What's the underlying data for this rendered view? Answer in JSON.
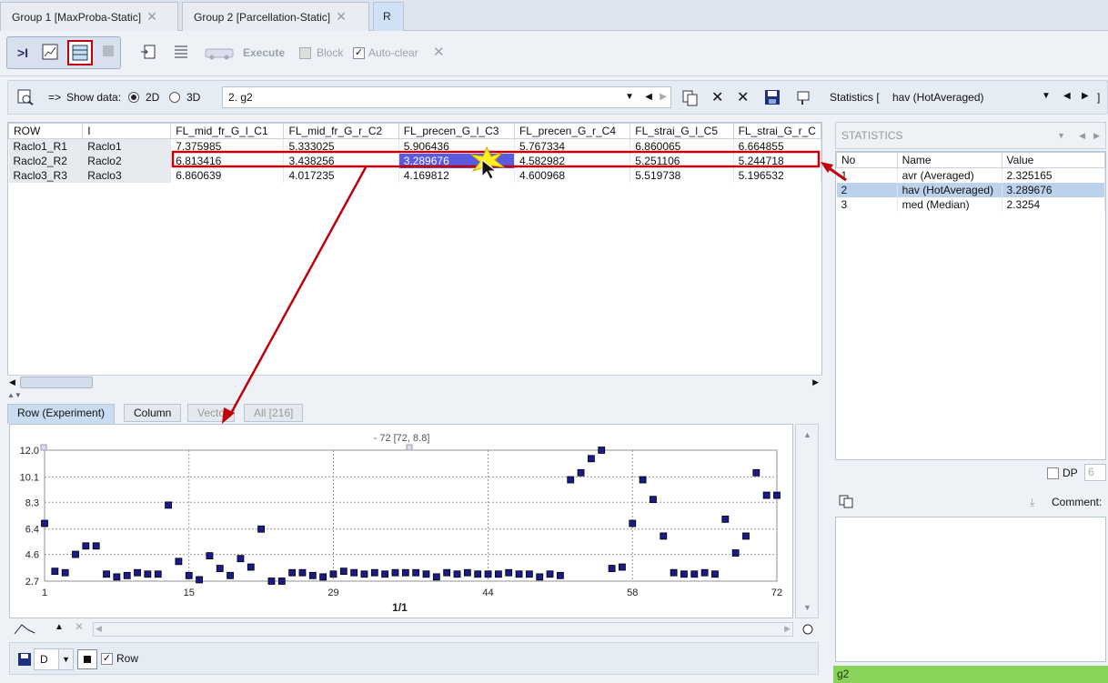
{
  "tabs": [
    {
      "label": "Group 1 [MaxProba-Static]"
    },
    {
      "label": "Group 2 [Parcellation-Static]"
    },
    {
      "label": "R"
    }
  ],
  "toolbar": {
    "execute": "Execute",
    "block": "Block",
    "autoclear": "Auto-clear"
  },
  "showdata": {
    "arrow_label": "=>",
    "label": "Show data:",
    "opt2d": "2D",
    "opt3d": "3D",
    "selection": "2. g2",
    "stats_label": "Statistics [",
    "stats_value": "hav (HotAveraged)",
    "stats_close": "]"
  },
  "table": {
    "columns": [
      "ROW",
      "I",
      "FL_mid_fr_G_l_C1",
      "FL_mid_fr_G_r_C2",
      "FL_precen_G_l_C3",
      "FL_precen_G_r_C4",
      "FL_strai_G_l_C5",
      "FL_strai_G_r_C"
    ],
    "rows": [
      [
        "Raclo1_R1",
        "Raclo1",
        "7.375985",
        "5.333025",
        "5.906436",
        "5.767334",
        "6.860065",
        "6.664855"
      ],
      [
        "Raclo2_R2",
        "Raclo2",
        "6.813416",
        "3.438256",
        "3.289676",
        "4.582982",
        "5.251106",
        "5.244718"
      ],
      [
        "Raclo3_R3",
        "Raclo3",
        "6.860639",
        "4.017235",
        "4.169812",
        "4.600968",
        "5.519738",
        "5.196532"
      ]
    ]
  },
  "bottom_tabs": [
    "Row (Experiment)",
    "Column",
    "Vecto",
    "All [216]"
  ],
  "chart_data": {
    "type": "scatter",
    "top_label": "- 72 [72, 8.8]",
    "page_label": "1/1",
    "ylim": [
      2.7,
      12.0
    ],
    "xlim": [
      1,
      72
    ],
    "xticks": [
      "1",
      "15",
      "29",
      "44",
      "58",
      "72"
    ],
    "yticks": [
      "12.0",
      "10.1",
      "8.3",
      "6.4",
      "4.6",
      "2.7"
    ],
    "marker_color": "#1a1a8c",
    "y": [
      6.8,
      3.4,
      3.3,
      4.6,
      5.2,
      5.2,
      3.2,
      3.0,
      3.1,
      3.3,
      3.2,
      3.2,
      8.1,
      4.1,
      3.1,
      2.8,
      4.5,
      3.6,
      3.1,
      4.3,
      3.7,
      6.4,
      2.7,
      2.7,
      3.3,
      3.3,
      3.1,
      3.0,
      3.2,
      3.4,
      3.3,
      3.2,
      3.3,
      3.2,
      3.3,
      3.3,
      3.3,
      3.2,
      3.0,
      3.3,
      3.2,
      3.3,
      3.2,
      3.2,
      3.2,
      3.3,
      3.2,
      3.2,
      3.0,
      3.2,
      3.1,
      9.9,
      10.4,
      11.4,
      12.0,
      3.6,
      3.7,
      6.8,
      9.9,
      8.5,
      5.9,
      3.3,
      3.2,
      3.2,
      3.3,
      3.2,
      7.1,
      4.7,
      5.9,
      10.4,
      8.8,
      8.8
    ]
  },
  "bottom_controls": {
    "combo": "D",
    "row_label": "Row"
  },
  "statistics": {
    "header": "STATISTICS",
    "columns": [
      "No",
      "Name",
      "Value"
    ],
    "rows": [
      [
        "1",
        "avr (Averaged)",
        "2.325165"
      ],
      [
        "2",
        "hav (HotAveraged)",
        "3.289676"
      ],
      [
        "3",
        "med (Median)",
        "2.3254"
      ]
    ],
    "dp_label": "DP",
    "dp_value": "6",
    "comment_label": "Comment:",
    "footer": "g2"
  },
  "colors": {
    "annotation": "#c0000a",
    "selection": "#5a5ae0",
    "highlight_row": "#bcd2ec"
  }
}
